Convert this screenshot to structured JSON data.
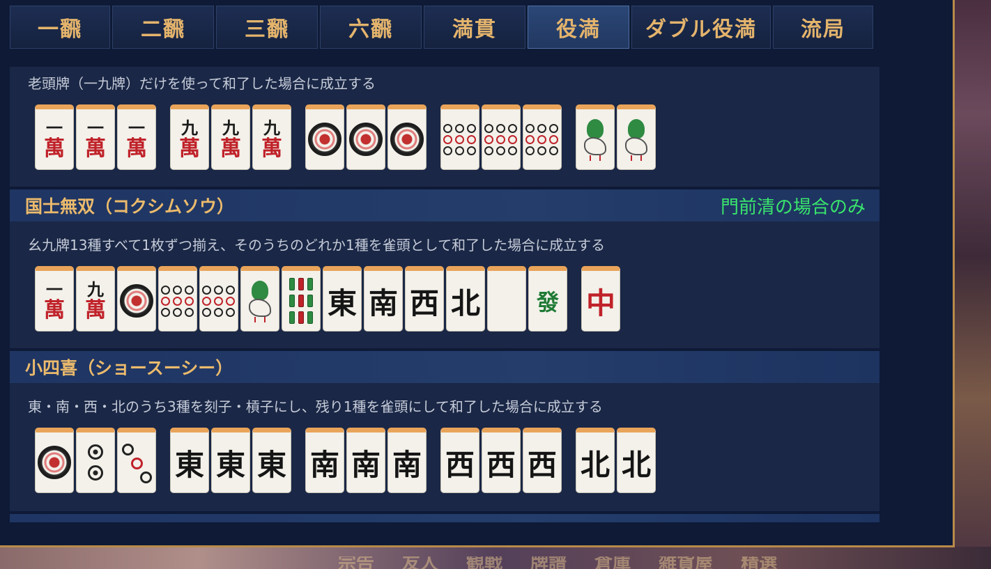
{
  "tabs": [
    "一飜",
    "二飜",
    "三飜",
    "六飜",
    "満貫",
    "役満",
    "ダブル役満",
    "流局"
  ],
  "active_tab": "役満",
  "sections": [
    {
      "title": "",
      "condition": "",
      "description": "老頭牌（一九牌）だけを使って和了した場合に成立する",
      "tiles": [
        {
          "kind": "man",
          "top": "一",
          "bottom": "萬"
        },
        {
          "kind": "man",
          "top": "一",
          "bottom": "萬"
        },
        {
          "kind": "man",
          "top": "一",
          "bottom": "萬"
        },
        {
          "kind": "man",
          "top": "九",
          "bottom": "萬"
        },
        {
          "kind": "man",
          "top": "九",
          "bottom": "萬"
        },
        {
          "kind": "man",
          "top": "九",
          "bottom": "萬"
        },
        {
          "kind": "pin1"
        },
        {
          "kind": "pin1"
        },
        {
          "kind": "pin1"
        },
        {
          "kind": "pin9"
        },
        {
          "kind": "pin9"
        },
        {
          "kind": "pin9"
        },
        {
          "kind": "sou1"
        },
        {
          "kind": "sou1"
        }
      ]
    },
    {
      "title": "国士無双（コクシムソウ）",
      "condition": "門前清の場合のみ",
      "description": "幺九牌13種すべて1枚ずつ揃え、そのうちのどれか1種を雀頭として和了した場合に成立する",
      "tiles": [
        {
          "kind": "man",
          "top": "一",
          "bottom": "萬"
        },
        {
          "kind": "man",
          "top": "九",
          "bottom": "萬"
        },
        {
          "kind": "pin1"
        },
        {
          "kind": "pin9"
        },
        {
          "kind": "pin9"
        },
        {
          "kind": "sou1"
        },
        {
          "kind": "sou9"
        },
        {
          "kind": "honor",
          "text": "東"
        },
        {
          "kind": "honor",
          "text": "南"
        },
        {
          "kind": "honor",
          "text": "西"
        },
        {
          "kind": "honor",
          "text": "北"
        },
        {
          "kind": "honor",
          "text": ""
        },
        {
          "kind": "honor",
          "text": "發",
          "color": "green"
        },
        {
          "kind": "honor",
          "text": "中",
          "color": "red"
        }
      ]
    },
    {
      "title": "小四喜（ショースーシー）",
      "condition": "",
      "description": "東・南・西・北のうち3種を刻子・槓子にし、残り1種を雀頭にして和了した場合に成立する",
      "tiles": [
        {
          "kind": "pin1"
        },
        {
          "kind": "pin2"
        },
        {
          "kind": "pin3"
        },
        {
          "kind": "honor",
          "text": "東"
        },
        {
          "kind": "honor",
          "text": "東"
        },
        {
          "kind": "honor",
          "text": "東"
        },
        {
          "kind": "honor",
          "text": "南"
        },
        {
          "kind": "honor",
          "text": "南"
        },
        {
          "kind": "honor",
          "text": "南"
        },
        {
          "kind": "honor",
          "text": "西"
        },
        {
          "kind": "honor",
          "text": "西"
        },
        {
          "kind": "honor",
          "text": "西"
        },
        {
          "kind": "honor",
          "text": "北"
        },
        {
          "kind": "honor",
          "text": "北"
        }
      ]
    }
  ],
  "colors": {
    "title": "#ecbb6c",
    "condition": "#39e56c",
    "man_red": "#c0222a",
    "tile_top": "#e9a45a"
  }
}
